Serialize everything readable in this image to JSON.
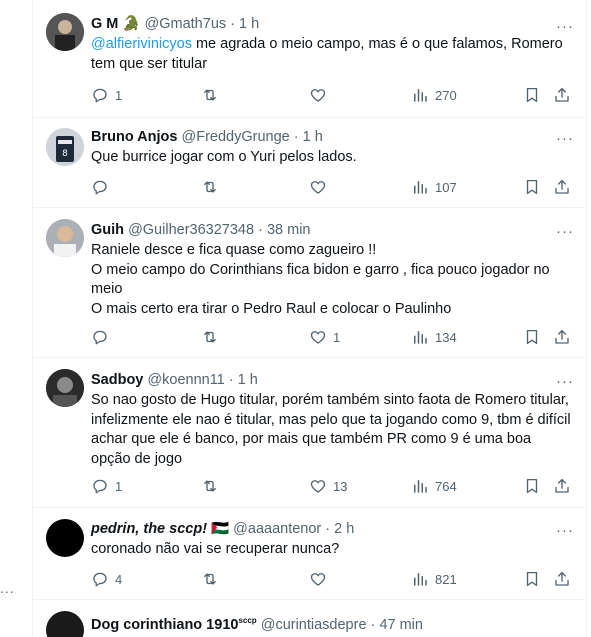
{
  "tweets": [
    {
      "name": "G M",
      "name_emoji": "🐊",
      "handle": "@Gmath7us",
      "time": "1 h",
      "mention": "@alfierivinicyos",
      "text": " me agrada o meio campo, mas é o que falamos, Romero tem que ser titular",
      "replies": "1",
      "retweets": "",
      "likes": "",
      "views": "270"
    },
    {
      "name": "Bruno Anjos",
      "handle": "@FreddyGrunge",
      "time": "1 h",
      "text": "Que burrice jogar com o Yuri pelos lados.",
      "replies": "",
      "retweets": "",
      "likes": "",
      "views": "107"
    },
    {
      "name": "Guih",
      "handle": "@Guilher36327348",
      "time": "38 min",
      "text": "Raniele desce e fica quase como zagueiro !!\nO meio campo do Corinthians fica bidon e garro , fica pouco jogador no meio\nO mais certo era tirar o Pedro Raul e colocar o Paulinho",
      "replies": "",
      "retweets": "",
      "likes": "1",
      "views": "134"
    },
    {
      "name": "Sadboy",
      "handle": "@koennn11",
      "time": "1 h",
      "text": "So nao gosto de Hugo titular, porém também sinto faota de Romero titular, infelizmente ele nao é titular, mas pelo que ta jogando como 9, tbm é difícil achar que ele é banco, por mais que também PR como 9 é uma boa opção de jogo",
      "replies": "1",
      "retweets": "",
      "likes": "13",
      "views": "764"
    },
    {
      "name": "pedrin, the sccp!",
      "name_flag": "🇵🇸",
      "handle": "@aaaantenor",
      "time": "2 h",
      "text": "coronado não vai se recuperar nunca?",
      "replies": "4",
      "retweets": "",
      "likes": "",
      "views": "821"
    },
    {
      "name": "Dog corinthiano 1910",
      "name_suffix": "sccp",
      "handle": "@curintiasdepre",
      "time": "47 min"
    }
  ],
  "ui": {
    "separator": "·",
    "more": "···",
    "left_edge_dots": "..."
  },
  "colors": {
    "text": "#0f1419",
    "secondary": "#536471",
    "link": "#1d9bf0",
    "border": "#eff3f4"
  }
}
